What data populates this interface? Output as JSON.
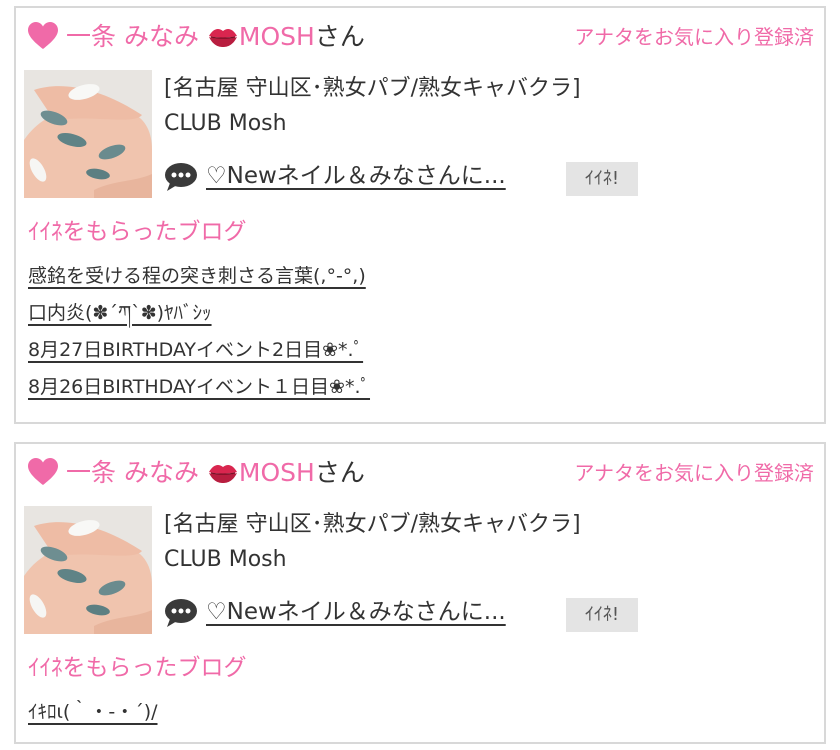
{
  "colors": {
    "accent_pink": "#f06aa8",
    "text": "#333333",
    "card_border": "#d8d8d8",
    "iine_button_bg": "#e4e4e4"
  },
  "icons": {
    "heart": "heart-icon",
    "lips": "lips-icon",
    "speech": "speech-bubble-icon"
  },
  "cards": [
    {
      "cast_name_prefix": "一条 みなみ",
      "cast_name_suffix": "MOSH",
      "honorific": "さん",
      "favorite_status": "アナタをお気に入り登録済",
      "shop_area": "[名古屋 守山区･熟女パブ/熟女キャバクラ]",
      "shop_name": "CLUB Mosh",
      "latest_post_title": "♡Newネイル＆みなさんに...",
      "iine_button_label": "ｲｲﾈ!",
      "blogs_heading": "ｲｲﾈをもらったブログ",
      "blogs": [
        "感銘を受ける程の突き刺さる言葉(,°-°,)",
        "口内炎(✽´ཀ`✽)ﾔﾊﾞｼｯ",
        "8月27日BIRTHDAYイベント2日目❀*.ﾟ",
        "8月26日BIRTHDAYイベント１日目❀*.ﾟ"
      ]
    },
    {
      "cast_name_prefix": "一条 みなみ",
      "cast_name_suffix": "MOSH",
      "honorific": "さん",
      "favorite_status": "アナタをお気に入り登録済",
      "shop_area": "[名古屋 守山区･熟女パブ/熟女キャバクラ]",
      "shop_name": "CLUB Mosh",
      "latest_post_title": "♡Newネイル＆みなさんに...",
      "iine_button_label": "ｲｲﾈ!",
      "blogs_heading": "ｲｲﾈをもらったブログ",
      "blogs": [
        "ｲｷﾛι(｀・-・´)/"
      ]
    }
  ]
}
